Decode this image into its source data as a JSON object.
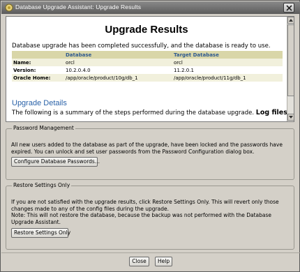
{
  "window": {
    "title": "Database Upgrade Assistant: Upgrade Results"
  },
  "results": {
    "heading": "Upgrade Results",
    "message": "Database upgrade has been completed successfully, and the database is ready to use.",
    "table": {
      "headers": [
        "",
        "Database",
        "Target Database"
      ],
      "rows": [
        [
          "Name:",
          "orcl",
          "orcl"
        ],
        [
          "Version:",
          "10.2.0.4.0",
          "11.2.0.1"
        ],
        [
          "Oracle Home:",
          "/app/oracle/product/10g/db_1",
          "/app/oracle/product/11g/db_1"
        ]
      ]
    },
    "details_heading": "Upgrade Details",
    "details_text": "The following is a summary of the steps performed during the database upgrade.",
    "details_link": "Log files"
  },
  "password_management": {
    "legend": "Password Management",
    "text": "All new users added to the database as part of the upgrade, have been locked and the passwords have expired. You can unlock and set user passwords from the Password Configuration dialog box.",
    "button": "Configure Database Passwords..."
  },
  "restore_settings": {
    "legend": "Restore Settings Only",
    "text_line1": "If you are not satisfied with the upgrade results, click Restore Settings Only. This will revert only those changes made to any of the config files during the upgrade.",
    "text_line2": "Note: This will not restore the database, because the backup was not performed with the Database Upgrade Assistant.",
    "button": "Restore Settings Only"
  },
  "footer": {
    "close_label": "Close",
    "help_label": "Help"
  }
}
